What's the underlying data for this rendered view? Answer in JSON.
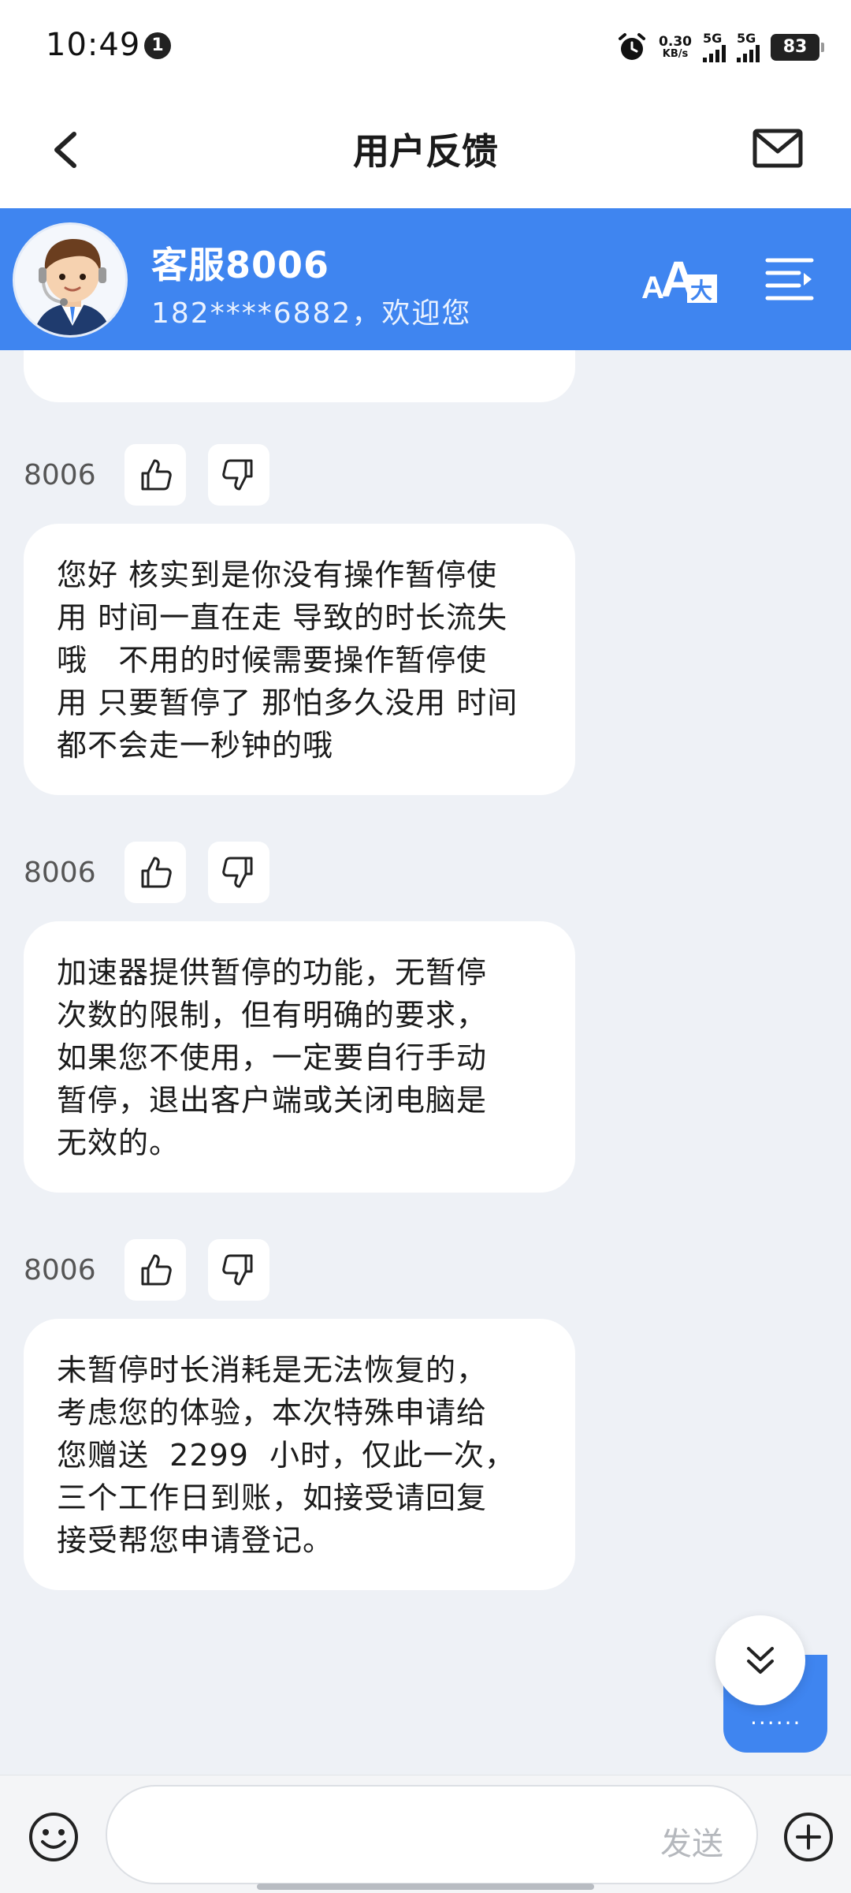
{
  "status_bar": {
    "time": "10:49",
    "notification_count": "1",
    "net_speed_value": "0.30",
    "net_speed_unit": "KB/s",
    "sim1_label": "5G",
    "sim2_label": "5G",
    "battery": "83"
  },
  "header": {
    "title": "用户反馈",
    "back_icon": "chevron-left-icon",
    "mail_icon": "mail-icon"
  },
  "agent": {
    "name": "客服8006",
    "subtitle": "182****6882，欢迎您",
    "font_icon": "font-size-icon",
    "menu_icon": "menu-icon"
  },
  "messages": [
    {
      "sender": "8006",
      "text": "您好 核实到是你没有操作暂停使\n用 时间一直在走 导致的时长流失\n哦   不用的时候需要操作暂停使\n用 只要暂停了 那怕多久没用 时间\n都不会走一秒钟的哦"
    },
    {
      "sender": "8006",
      "text": "加速器提供暂停的功能，无暂停\n次数的限制，但有明确的要求，\n如果您不使用，一定要自行手动\n暂停，退出客户端或关闭电脑是\n无效的。"
    },
    {
      "sender": "8006",
      "text": "未暂停时长消耗是无法恢复的，\n考虑您的体验，本次特殊申请给\n您赠送  2299  小时，仅此一次，\n三个工作日到账，如接受请回复\n接受帮您申请登记。"
    }
  ],
  "floating": {
    "tab_label": "......"
  },
  "input_bar": {
    "placeholder": "",
    "send_label": "发送"
  },
  "colors": {
    "accent": "#3f85f0",
    "background": "#eef1f6"
  }
}
